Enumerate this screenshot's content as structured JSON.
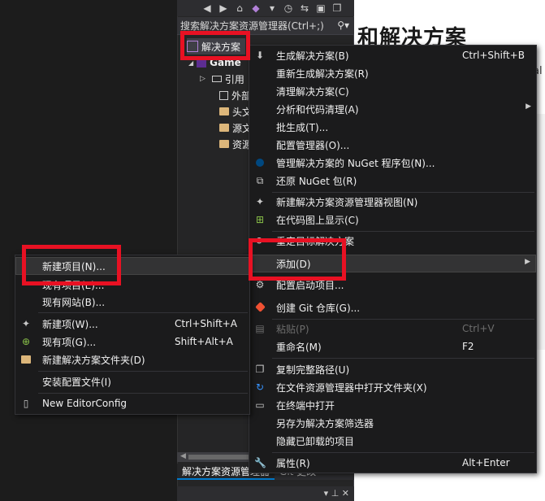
{
  "document": {
    "title": "和解决方案",
    "cut_text": "al"
  },
  "solution_explorer": {
    "search_placeholder": "搜索解决方案资源管理器(Ctrl+;)",
    "tree": {
      "solution_label": "解决方案",
      "project_label": "Game",
      "items": [
        "引用",
        "外部",
        "头文",
        "源文",
        "资源"
      ]
    },
    "tabs": [
      "解决方案资源管理器",
      "Git 更改"
    ]
  },
  "context_menu": {
    "items": [
      {
        "label": "生成解决方案(B)",
        "shortcut": "Ctrl+Shift+B",
        "icon": "build-icon"
      },
      {
        "label": "重新生成解决方案(R)",
        "shortcut": "",
        "icon": ""
      },
      {
        "label": "清理解决方案(C)",
        "shortcut": "",
        "icon": ""
      },
      {
        "label": "分析和代码清理(A)",
        "shortcut": "",
        "icon": "",
        "submenu": true
      },
      {
        "label": "批生成(T)...",
        "shortcut": "",
        "icon": ""
      },
      {
        "label": "配置管理器(O)...",
        "shortcut": "",
        "icon": ""
      },
      {
        "label": "管理解决方案的 NuGet 程序包(N)...",
        "shortcut": "",
        "icon": "nuget-icon"
      },
      {
        "label": "还原 NuGet 包(R)",
        "shortcut": "",
        "icon": "restore-icon"
      },
      {
        "label": "新建解决方案资源管理器视图(N)",
        "shortcut": "",
        "icon": "new-view-icon"
      },
      {
        "label": "在代码图上显示(C)",
        "shortcut": "",
        "icon": "code-map-icon"
      },
      {
        "label": "重定目标解决方案",
        "shortcut": "",
        "icon": "retarget-icon"
      },
      {
        "label": "添加(D)",
        "shortcut": "",
        "icon": "",
        "submenu": true
      },
      {
        "label": "配置启动项目...",
        "shortcut": "",
        "icon": "gear-icon"
      },
      {
        "label": "创建 Git 仓库(G)...",
        "shortcut": "",
        "icon": "git-icon"
      },
      {
        "label": "粘贴(P)",
        "shortcut": "Ctrl+V",
        "icon": "paste-icon",
        "disabled": true
      },
      {
        "label": "重命名(M)",
        "shortcut": "F2",
        "icon": ""
      },
      {
        "label": "复制完整路径(U)",
        "shortcut": "",
        "icon": "copy-icon"
      },
      {
        "label": "在文件资源管理器中打开文件夹(X)",
        "shortcut": "",
        "icon": "refresh-icon"
      },
      {
        "label": "在终端中打开",
        "shortcut": "",
        "icon": "terminal-icon"
      },
      {
        "label": "另存为解决方案筛选器",
        "shortcut": "",
        "icon": ""
      },
      {
        "label": "隐藏已卸载的项目",
        "shortcut": "",
        "icon": ""
      },
      {
        "label": "属性(R)",
        "shortcut": "Alt+Enter",
        "icon": "wrench-icon"
      }
    ]
  },
  "add_submenu": {
    "items": [
      {
        "label": "新建项目(N)...",
        "shortcut": "",
        "icon": ""
      },
      {
        "label": "现有项目(E)...",
        "shortcut": "",
        "icon": ""
      },
      {
        "label": "现有网站(B)...",
        "shortcut": "",
        "icon": ""
      },
      {
        "label": "新建项(W)...",
        "shortcut": "Ctrl+Shift+A",
        "icon": "new-item-icon"
      },
      {
        "label": "现有项(G)...",
        "shortcut": "Shift+Alt+A",
        "icon": "existing-item-icon"
      },
      {
        "label": "新建解决方案文件夹(D)",
        "shortcut": "",
        "icon": "new-folder-icon"
      },
      {
        "label": "安装配置文件(I)",
        "shortcut": "",
        "icon": ""
      },
      {
        "label": "New EditorConfig",
        "shortcut": "",
        "icon": "file-icon"
      }
    ]
  },
  "colors": {
    "highlight_box": "#e81123",
    "menu_bg": "#1b1b1c",
    "panel_bg": "#252526"
  }
}
